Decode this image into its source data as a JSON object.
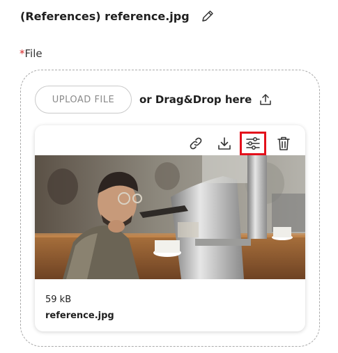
{
  "header": {
    "title": "(References) reference.jpg",
    "edit_icon": "pencil-icon"
  },
  "field": {
    "required_mark": "*",
    "label": "File"
  },
  "upload": {
    "button_label": "UPLOAD FILE",
    "drag_text": "or Drag&Drop here",
    "icon": "upload-icon"
  },
  "file_card": {
    "actions": [
      {
        "name": "link-icon"
      },
      {
        "name": "download-icon"
      },
      {
        "name": "adjust-icon"
      },
      {
        "name": "trash-icon"
      }
    ],
    "image_alt": "reference.jpg",
    "size": "59 kB",
    "filename": "reference.jpg"
  },
  "colors": {
    "required": "#d62b2b",
    "highlight": "#e3101b",
    "border": "#a9a9a9"
  }
}
